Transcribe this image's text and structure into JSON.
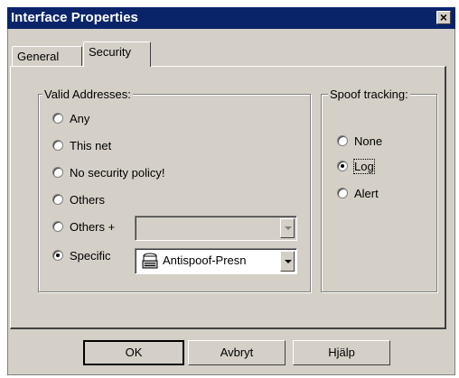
{
  "window": {
    "title": "Interface Properties"
  },
  "tabs": [
    {
      "label": "General",
      "active": false
    },
    {
      "label": "Security",
      "active": true
    }
  ],
  "valid_addresses": {
    "label": "Valid Addresses:",
    "options": [
      {
        "label": "Any",
        "checked": false
      },
      {
        "label": "This net",
        "checked": false
      },
      {
        "label": "No security policy!",
        "checked": false
      },
      {
        "label": "Others",
        "checked": false
      },
      {
        "label": "Others +",
        "checked": false
      },
      {
        "label": "Specific",
        "checked": true
      }
    ],
    "others_plus_combo": {
      "value": ""
    },
    "specific_combo": {
      "value": "Antispoof-Presn",
      "icon": "object-group-icon"
    }
  },
  "spoof_tracking": {
    "label": "Spoof tracking:",
    "options": [
      {
        "label": "None",
        "checked": false
      },
      {
        "label": "Log",
        "checked": true
      },
      {
        "label": "Alert",
        "checked": false
      }
    ]
  },
  "buttons": {
    "ok": "OK",
    "cancel": "Avbryt",
    "help": "Hjälp"
  }
}
